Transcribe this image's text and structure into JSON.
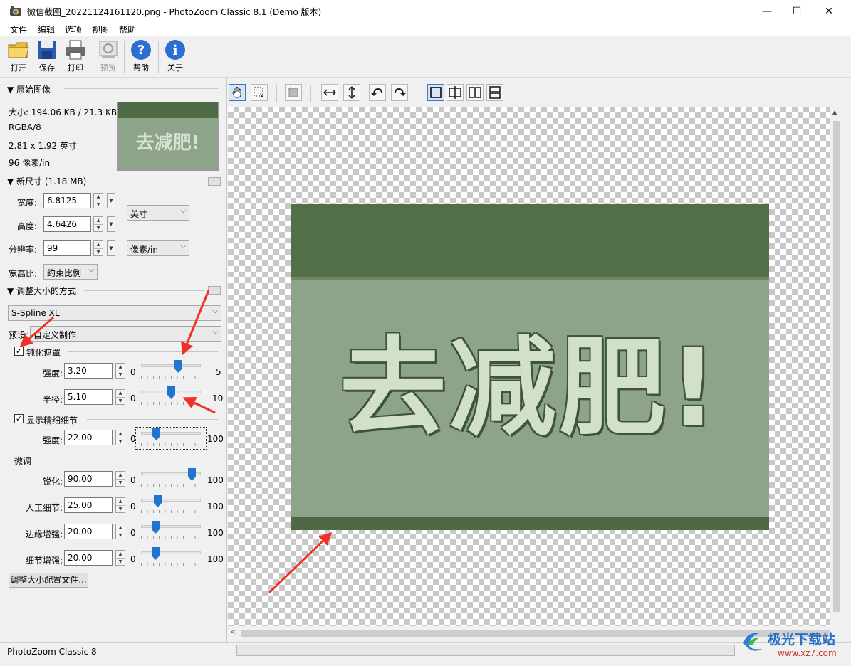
{
  "window": {
    "title": "微信截图_20221124161120.png - PhotoZoom Classic 8.1 (Demo 版本)",
    "minimize": "—",
    "maximize": "☐",
    "close": "✕"
  },
  "menu": [
    "文件",
    "编辑",
    "选项",
    "视图",
    "帮助"
  ],
  "toolbar": {
    "open": "打开",
    "save": "保存",
    "print": "打印",
    "preview": "预览",
    "help": "帮助",
    "about": "关于"
  },
  "original": {
    "header": "▼ 原始图像",
    "size": "大小: 194.06 KB / 21.3 KB",
    "mode": "RGBA/8",
    "dimensions": "2.81 x 1.92 英寸",
    "resolution": "96 像素/in",
    "thumb_text": "去减肥!"
  },
  "new_size": {
    "header": "▼ 新尺寸 (1.18 MB)",
    "more": "...",
    "width_label": "宽度:",
    "width_value": "6.8125",
    "height_label": "高度:",
    "height_value": "4.6426",
    "res_label": "分辨率:",
    "res_value": "99",
    "unit_value": "英寸",
    "res_unit_value": "像素/in",
    "aspect_label": "宽高比:",
    "aspect_value": "约束比例"
  },
  "resize_method": {
    "header": "▼ 调整大小的方式",
    "more": "...",
    "method_value": "S-Spline XL",
    "preset_label": "预设:",
    "preset_value": "自定义制作"
  },
  "unsharp": {
    "label": "钝化遮罩",
    "checked": "✓",
    "strength_label": "强度:",
    "strength_value": "3.20",
    "strength_min": "0",
    "strength_max": "5",
    "strength_level": 0.64,
    "radius_label": "半径:",
    "radius_value": "5.10",
    "radius_min": "0",
    "radius_max": "10",
    "radius_level": 0.51
  },
  "fine_detail": {
    "label": "显示精细细节",
    "checked": "✓",
    "strength_label": "强度:",
    "strength_value": "22.00",
    "min": "0",
    "max": "100",
    "level": 0.22
  },
  "tweak": {
    "header": "微调",
    "rows": [
      {
        "label": "锐化:",
        "value": "90.00",
        "min": "0",
        "max": "100",
        "level": 0.9
      },
      {
        "label": "人工细节:",
        "value": "25.00",
        "min": "0",
        "max": "100",
        "level": 0.25
      },
      {
        "label": "边缘增强:",
        "value": "20.00",
        "min": "0",
        "max": "100",
        "level": 0.2
      },
      {
        "label": "细节增强:",
        "value": "20.00",
        "min": "0",
        "max": "100",
        "level": 0.2
      }
    ]
  },
  "profile_button": "调整大小配置文件...",
  "image_text": "去减肥!",
  "status": "PhotoZoom Classic 8",
  "watermark": {
    "brand": "极光下载站",
    "url": "www.xz7.com"
  },
  "colors": {
    "accent": "#1f76d0",
    "banner_dark": "#4f6b45",
    "banner_body": "#8ea48a",
    "arrow": "#f0302a"
  }
}
